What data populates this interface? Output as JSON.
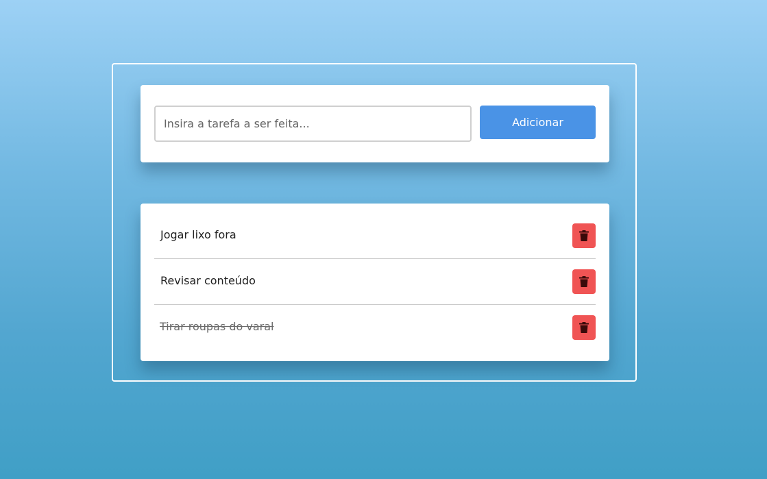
{
  "input_panel": {
    "placeholder": "Insira a tarefa a ser feita...",
    "value": "",
    "add_label": "Adicionar"
  },
  "tasks": [
    {
      "text": "Jogar lixo fora",
      "done": false
    },
    {
      "text": "Revisar conteúdo",
      "done": false
    },
    {
      "text": "Tirar roupas do varal",
      "done": true
    }
  ],
  "colors": {
    "accent": "#4a93e6",
    "delete": "#f05454",
    "background_top": "#9dd1f5",
    "background_bottom": "#409fc6"
  },
  "icons": {
    "delete": "trash-icon"
  }
}
